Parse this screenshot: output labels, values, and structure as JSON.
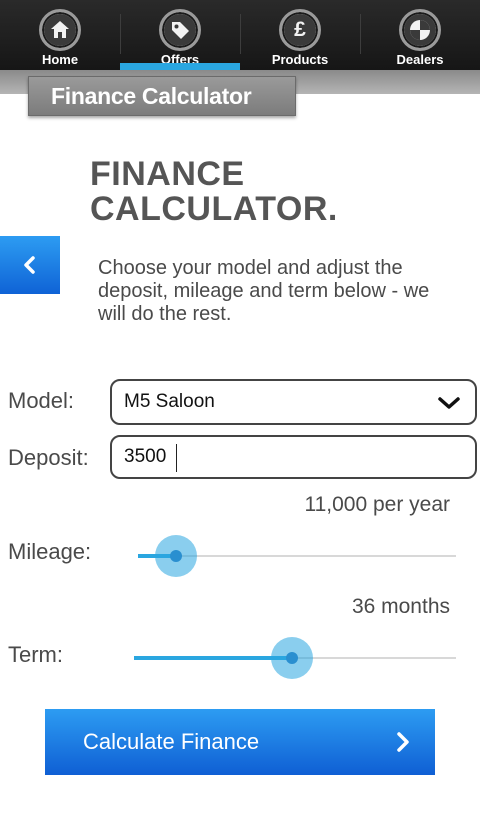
{
  "nav": {
    "items": [
      {
        "label": "Home",
        "icon": "home-icon",
        "active": false
      },
      {
        "label": "Offers",
        "icon": "tag-icon",
        "active": true
      },
      {
        "label": "Products",
        "icon": "pound-icon",
        "active": false
      },
      {
        "label": "Dealers",
        "icon": "location-icon",
        "active": false
      }
    ]
  },
  "page_tab": "Finance Calculator",
  "heading": {
    "line1": "FINANCE",
    "line2": "CALCULATOR."
  },
  "intro": "Choose your model and adjust the deposit, mileage and term below - we will do the rest.",
  "form": {
    "model_label": "Model:",
    "model_value": "M5 Saloon",
    "deposit_label": "Deposit:",
    "deposit_value": "3500",
    "mileage_label": "Mileage:",
    "mileage_value_text": "11,000 per year",
    "mileage_level": 0.12,
    "term_label": "Term:",
    "term_value_text": "36 months",
    "term_level": 0.49
  },
  "calculate_label": "Calculate Finance",
  "colors": {
    "accent": "#2aa6e0",
    "button": "#1a7fe6",
    "text": "#4a4a4a"
  }
}
